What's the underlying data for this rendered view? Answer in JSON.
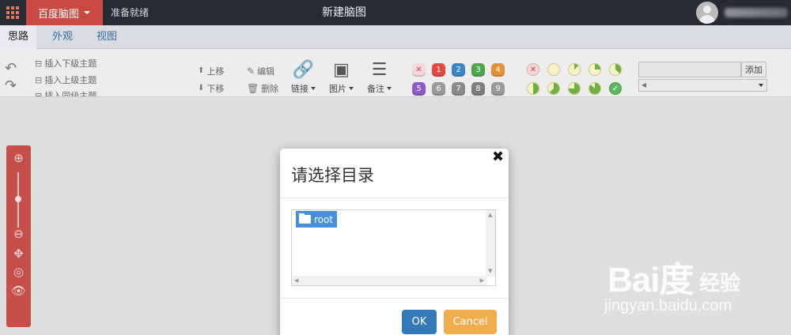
{
  "topbar": {
    "brand_label": "百度脑图",
    "status_text": "准备就绪",
    "document_title": "新建脑图"
  },
  "tabs": [
    "思路",
    "外观",
    "视图"
  ],
  "toolbar": {
    "insert_child": "插入下级主题",
    "insert_parent": "插入上级主题",
    "insert_sibling": "插入同级主题",
    "move_up": "上移",
    "move_down": "下移",
    "edit": "编辑",
    "delete": "删除",
    "link": "链接",
    "image": "图片",
    "note": "备注",
    "priorities": [
      "1",
      "2",
      "3",
      "4",
      "5",
      "6",
      "7",
      "8",
      "9"
    ],
    "progress_levels": [
      0,
      0.125,
      0.25,
      0.375,
      0.5,
      0.625,
      0.75,
      0.875,
      1
    ],
    "tag_add": "添加"
  },
  "modal": {
    "title": "请选择目录",
    "close_glyph": "✖",
    "tree_root": "root",
    "ok_label": "OK",
    "cancel_label": "Cancel"
  },
  "watermark": {
    "logo": "Bai度",
    "product": "经验",
    "url": "jingyan.baidu.com"
  },
  "colors": {
    "topbar": "#262a33",
    "brand": "#c94a43",
    "ok": "#337ab7",
    "cancel": "#f0ad4e",
    "zoom_panel": "#c54f4b",
    "tree_selected": "#4a90d9"
  }
}
